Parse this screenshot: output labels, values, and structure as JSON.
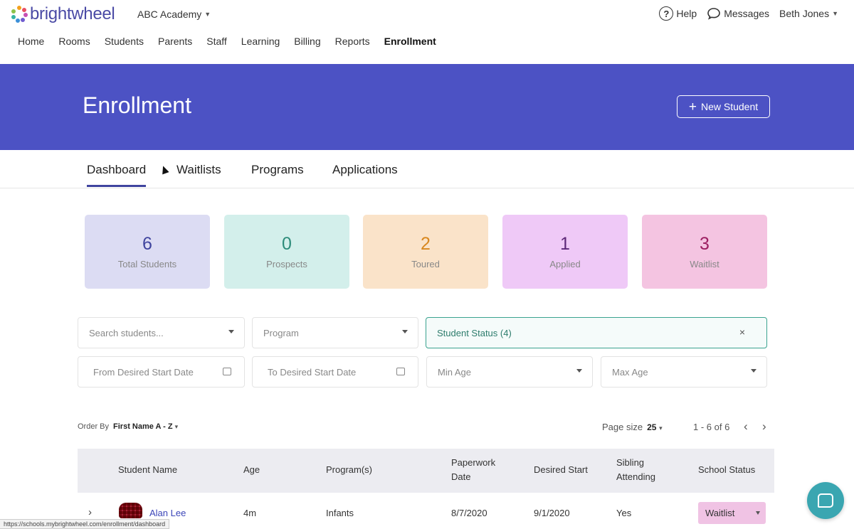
{
  "header": {
    "logo_text": "brightwheel",
    "school_name": "ABC Academy",
    "help_label": "Help",
    "messages_label": "Messages",
    "user_name": "Beth Jones"
  },
  "nav": [
    "Home",
    "Rooms",
    "Students",
    "Parents",
    "Staff",
    "Learning",
    "Billing",
    "Reports",
    "Enrollment"
  ],
  "nav_active": "Enrollment",
  "hero": {
    "title": "Enrollment",
    "new_student_label": "New Student"
  },
  "subtabs": [
    "Dashboard",
    "Waitlists",
    "Programs",
    "Applications"
  ],
  "subtab_active": "Dashboard",
  "stats": [
    {
      "value": "6",
      "label": "Total Students",
      "bg": "#dcdcf3",
      "color": "#3f449e"
    },
    {
      "value": "0",
      "label": "Prospects",
      "bg": "#d3efeb",
      "color": "#2d8c7a"
    },
    {
      "value": "2",
      "label": "Toured",
      "bg": "#fae3c9",
      "color": "#d9881f"
    },
    {
      "value": "1",
      "label": "Applied",
      "bg": "#efc9f7",
      "color": "#5c2878"
    },
    {
      "value": "3",
      "label": "Waitlist",
      "bg": "#f4c4e1",
      "color": "#9c1f62"
    }
  ],
  "filters": {
    "search_placeholder": "Search students...",
    "program_placeholder": "Program",
    "student_status_value": "Student Status (4)",
    "from_date_placeholder": "From Desired Start Date",
    "to_date_placeholder": "To Desired Start Date",
    "min_age_placeholder": "Min Age",
    "max_age_placeholder": "Max Age"
  },
  "ordering": {
    "order_by_label": "Order By",
    "order_by_value": "First Name A - Z",
    "page_size_label": "Page size",
    "page_size_value": "25",
    "range_text": "1 - 6 of 6"
  },
  "table": {
    "headers": {
      "student_name": "Student Name",
      "age": "Age",
      "programs": "Program(s)",
      "paperwork_date_1": "Paperwork",
      "paperwork_date_2": "Date",
      "desired_start": "Desired Start",
      "sibling_1": "Sibling",
      "sibling_2": "Attending",
      "school_status": "School Status"
    },
    "rows": [
      {
        "name": "Alan Lee",
        "age": "4m",
        "program": "Infants",
        "paperwork_date": "8/7/2020",
        "desired_start": "9/1/2020",
        "sibling": "Yes",
        "status": "Waitlist"
      }
    ]
  },
  "status_url": "https://schools.mybrightwheel.com/enrollment/dashboard"
}
